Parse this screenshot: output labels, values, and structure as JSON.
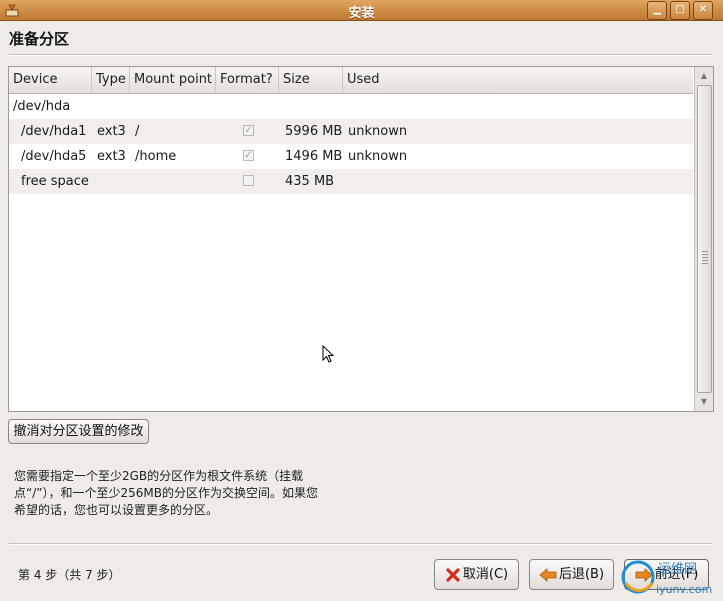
{
  "window": {
    "title": "安装",
    "buttons": [
      "minimize",
      "maximize",
      "close"
    ]
  },
  "page": {
    "title": "准备分区"
  },
  "table": {
    "columns": [
      "Device",
      "Type",
      "Mount point",
      "Format?",
      "Size",
      "Used"
    ],
    "rows": [
      {
        "device": "/dev/hda",
        "type": "",
        "mount": "",
        "format": null,
        "size": "",
        "used": ""
      },
      {
        "device": "/dev/hda1",
        "type": "ext3",
        "mount": "/",
        "format": true,
        "size": "5996 MB",
        "used": "unknown"
      },
      {
        "device": "/dev/hda5",
        "type": "ext3",
        "mount": "/home",
        "format": true,
        "size": "1496 MB",
        "used": "unknown"
      },
      {
        "device": "free space",
        "type": "",
        "mount": "",
        "format": false,
        "size": "435 MB",
        "used": ""
      }
    ]
  },
  "undo_button": {
    "label": "撤消对分区设置的修改"
  },
  "help_text": {
    "line1": "您需要指定一个至少2GB的分区作为根文件系统（挂载",
    "line2": "点“/”），和一个至少256MB的分区作为交换空间。如果您",
    "line3": "希望的话，您也可以设置更多的分区。"
  },
  "footer": {
    "step": "第 4 步（共 7 步）",
    "cancel_label": "取消(C)",
    "back_label": "后退(B)",
    "forward_label": "前进(F)"
  },
  "watermark": {
    "text_cn": "运维网",
    "text_url": "iyunv.com"
  },
  "icons": {
    "app": "installer-icon",
    "cancel": "red-x-icon",
    "back": "orange-left-arrow-icon",
    "forward": "orange-right-arrow-icon"
  },
  "colors": {
    "titlebar": "#c98a45",
    "background": "#efebe7",
    "row_alt": "#f1eeeb",
    "cancel_icon": "#d42a1e",
    "arrow_icon": "#e8891e"
  }
}
